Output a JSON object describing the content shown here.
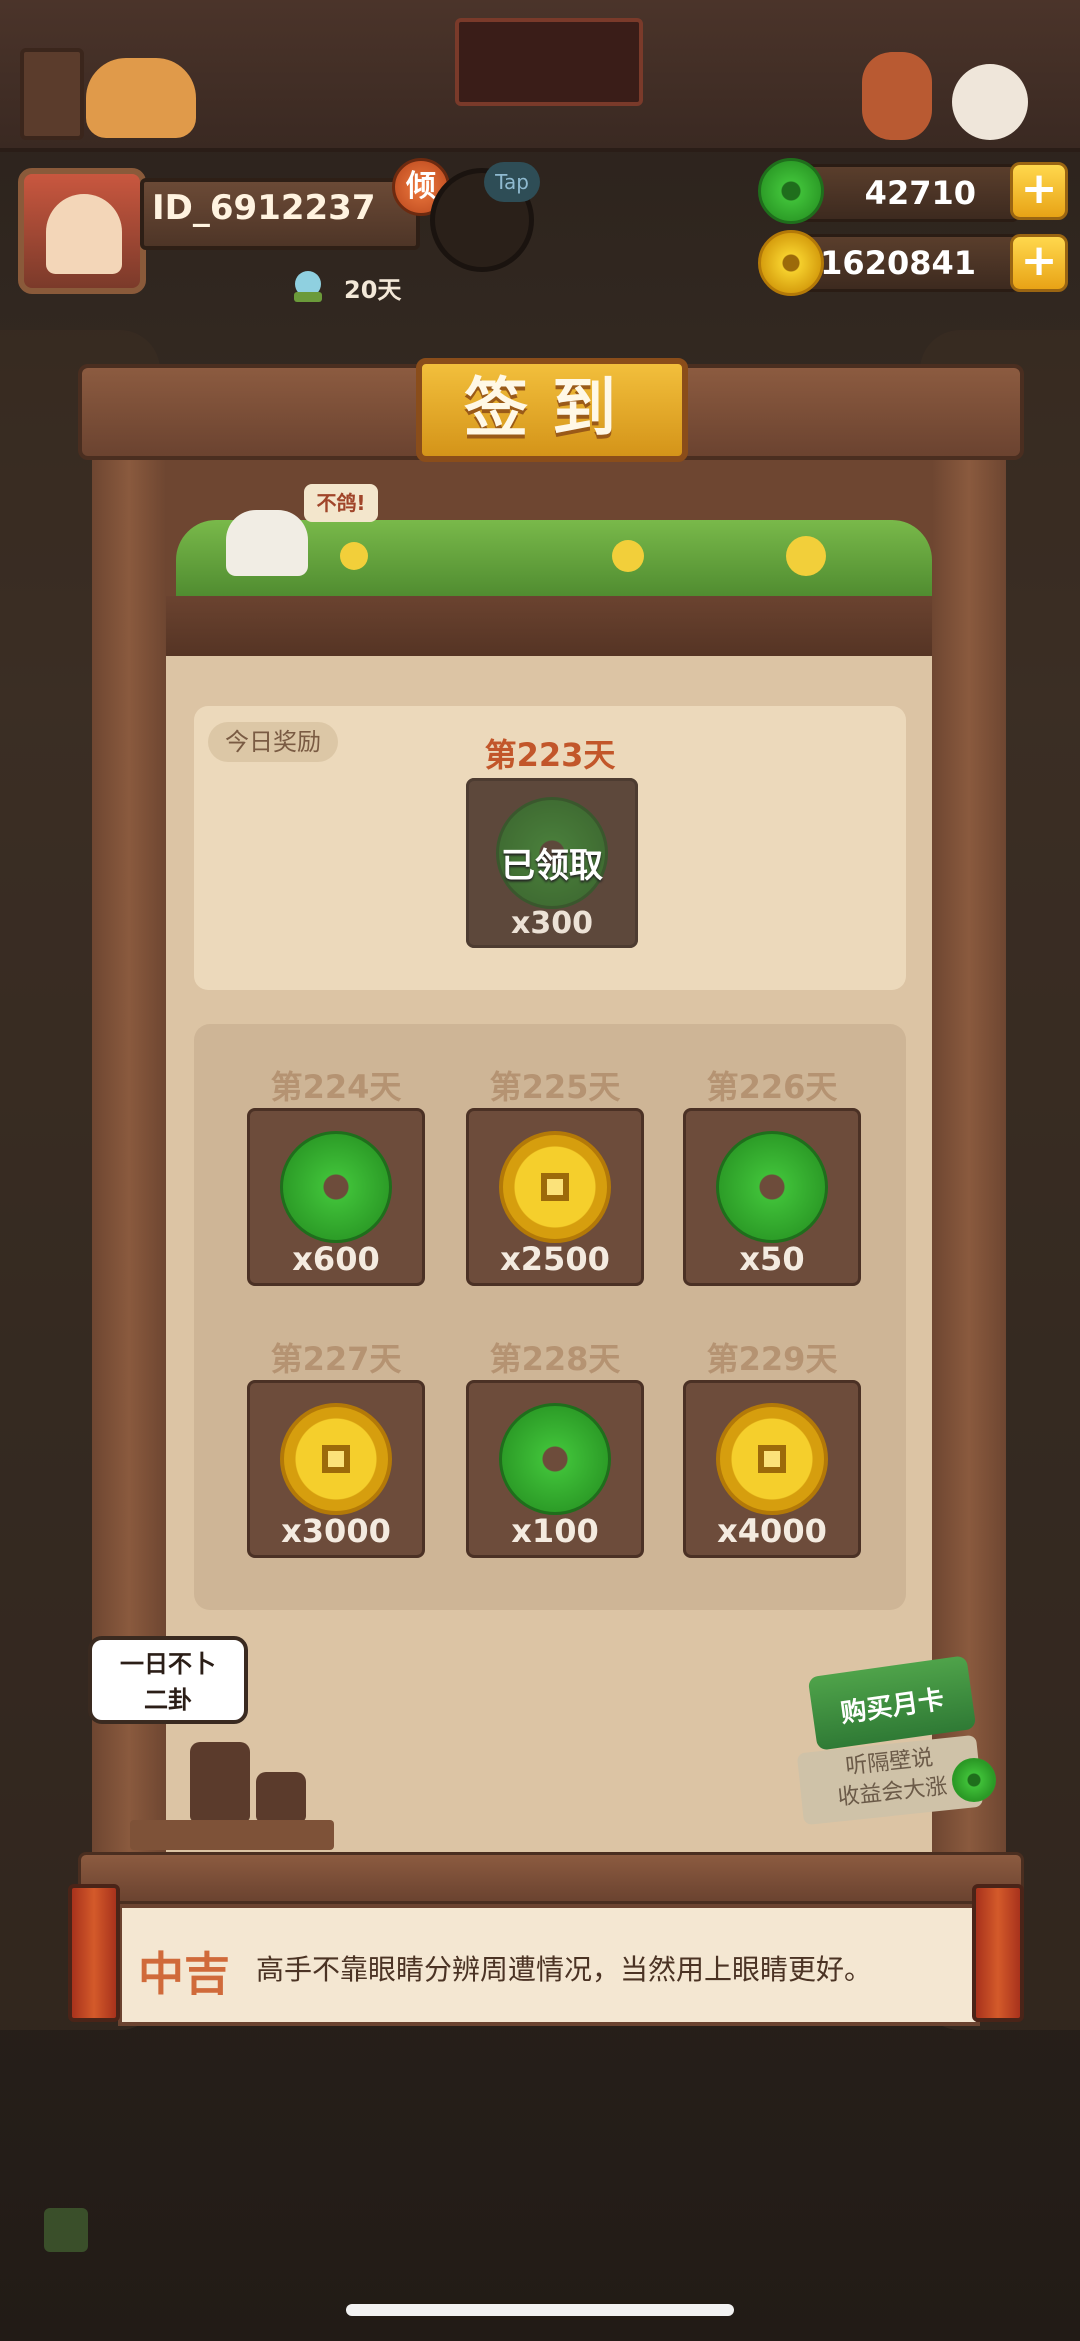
{
  "player": {
    "id": "ID_6912237",
    "rank_badge": "倾",
    "days_label": "20天",
    "tap_label": "Tap"
  },
  "currency": {
    "jade": "42710",
    "coins": "1620841",
    "plus": "+"
  },
  "signin": {
    "title": "签到",
    "bird_bubble": "不鸽!",
    "today_tag": "今日奖励",
    "today": {
      "day": "第223天",
      "status": "已领取",
      "qty": "x300",
      "reward": "jade"
    },
    "upcoming": [
      {
        "day": "第224天",
        "qty": "x600",
        "reward": "jade"
      },
      {
        "day": "第225天",
        "qty": "x2500",
        "reward": "coin"
      },
      {
        "day": "第226天",
        "qty": "x50",
        "reward": "jade"
      },
      {
        "day": "第227天",
        "qty": "x3000",
        "reward": "coin"
      },
      {
        "day": "第228天",
        "qty": "x100",
        "reward": "jade"
      },
      {
        "day": "第229天",
        "qty": "x4000",
        "reward": "coin"
      }
    ]
  },
  "speech_bubble": {
    "line1": "一日不卜",
    "line2": "二卦"
  },
  "monthly_card": {
    "title": "购买月卡",
    "line1": "听隔壁说",
    "line2": "收益会大涨"
  },
  "fortune": {
    "level": "中吉",
    "text": "高手不靠眼睛分辨周遭情况，当然用上眼睛更好。"
  },
  "colors": {
    "accent_gold": "#f2bf3c",
    "wood": "#8c5b40",
    "jade": "#3fbf38",
    "coin": "#f5cf2c",
    "fortune_red": "#d06a3a"
  }
}
